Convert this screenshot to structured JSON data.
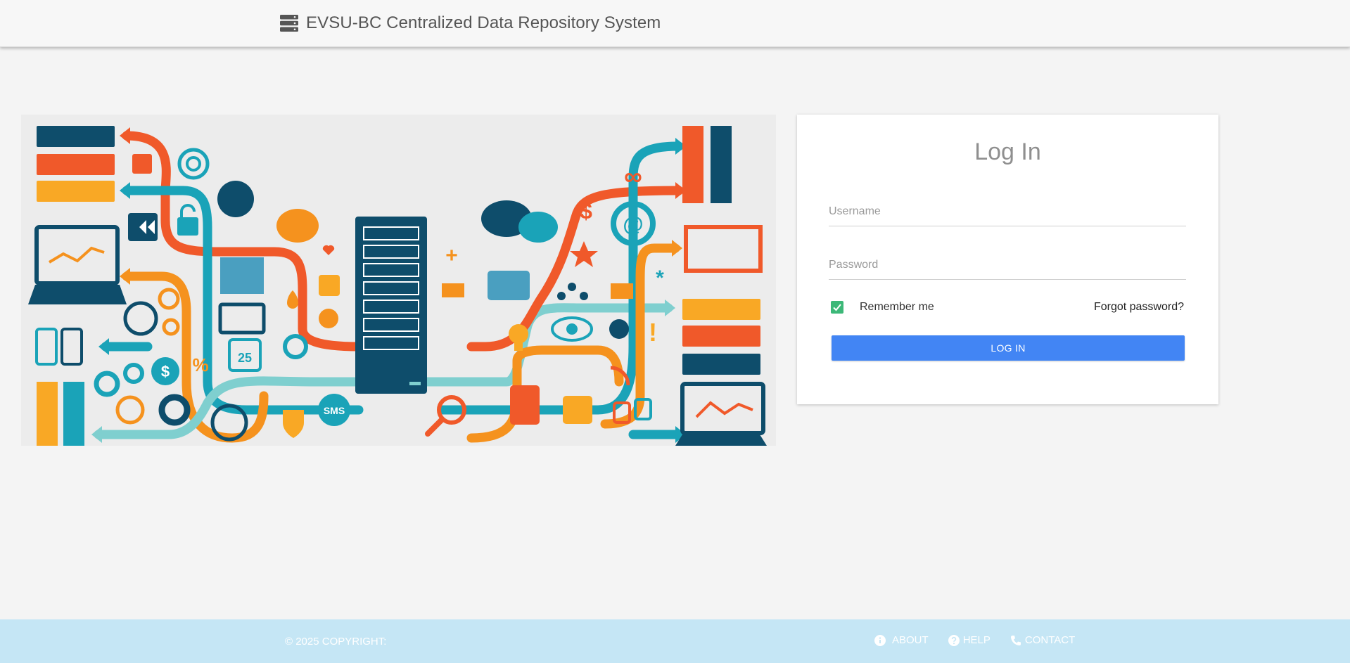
{
  "header": {
    "title": "EVSU-BC Centralized Data Repository System",
    "icon": "server-stack-icon"
  },
  "illustration": {
    "labels": {
      "calendar_day": "25",
      "sms": "SMS",
      "percent": "%",
      "dollar": "$",
      "at_sign": "@",
      "infinity": "∞",
      "exclaim": "!",
      "plus": "+",
      "asterisk": "*"
    }
  },
  "login": {
    "title": "Log In",
    "username_placeholder": "Username",
    "username_value": "",
    "password_placeholder": "Password",
    "password_value": "",
    "remember_label": "Remember me",
    "remember_checked": true,
    "forgot_label": "Forgot password?",
    "submit_label": "LOG IN"
  },
  "footer": {
    "copyright": "© 2025 COPYRIGHT:",
    "links": [
      {
        "label": "ABOUT",
        "icon": "info-icon"
      },
      {
        "label": "HELP",
        "icon": "question-icon"
      },
      {
        "label": "CONTACT",
        "icon": "phone-icon"
      }
    ]
  },
  "colors": {
    "accent": "#4285f4",
    "checkbox": "#3cb878",
    "footer": "#c5e6f5",
    "illus_navy": "#0e4d6b",
    "illus_teal": "#1aa3b8",
    "illus_orange": "#f5921e",
    "illus_red": "#f0592a",
    "illus_yellow": "#f9a825",
    "illus_mint": "#7fcfcf"
  }
}
